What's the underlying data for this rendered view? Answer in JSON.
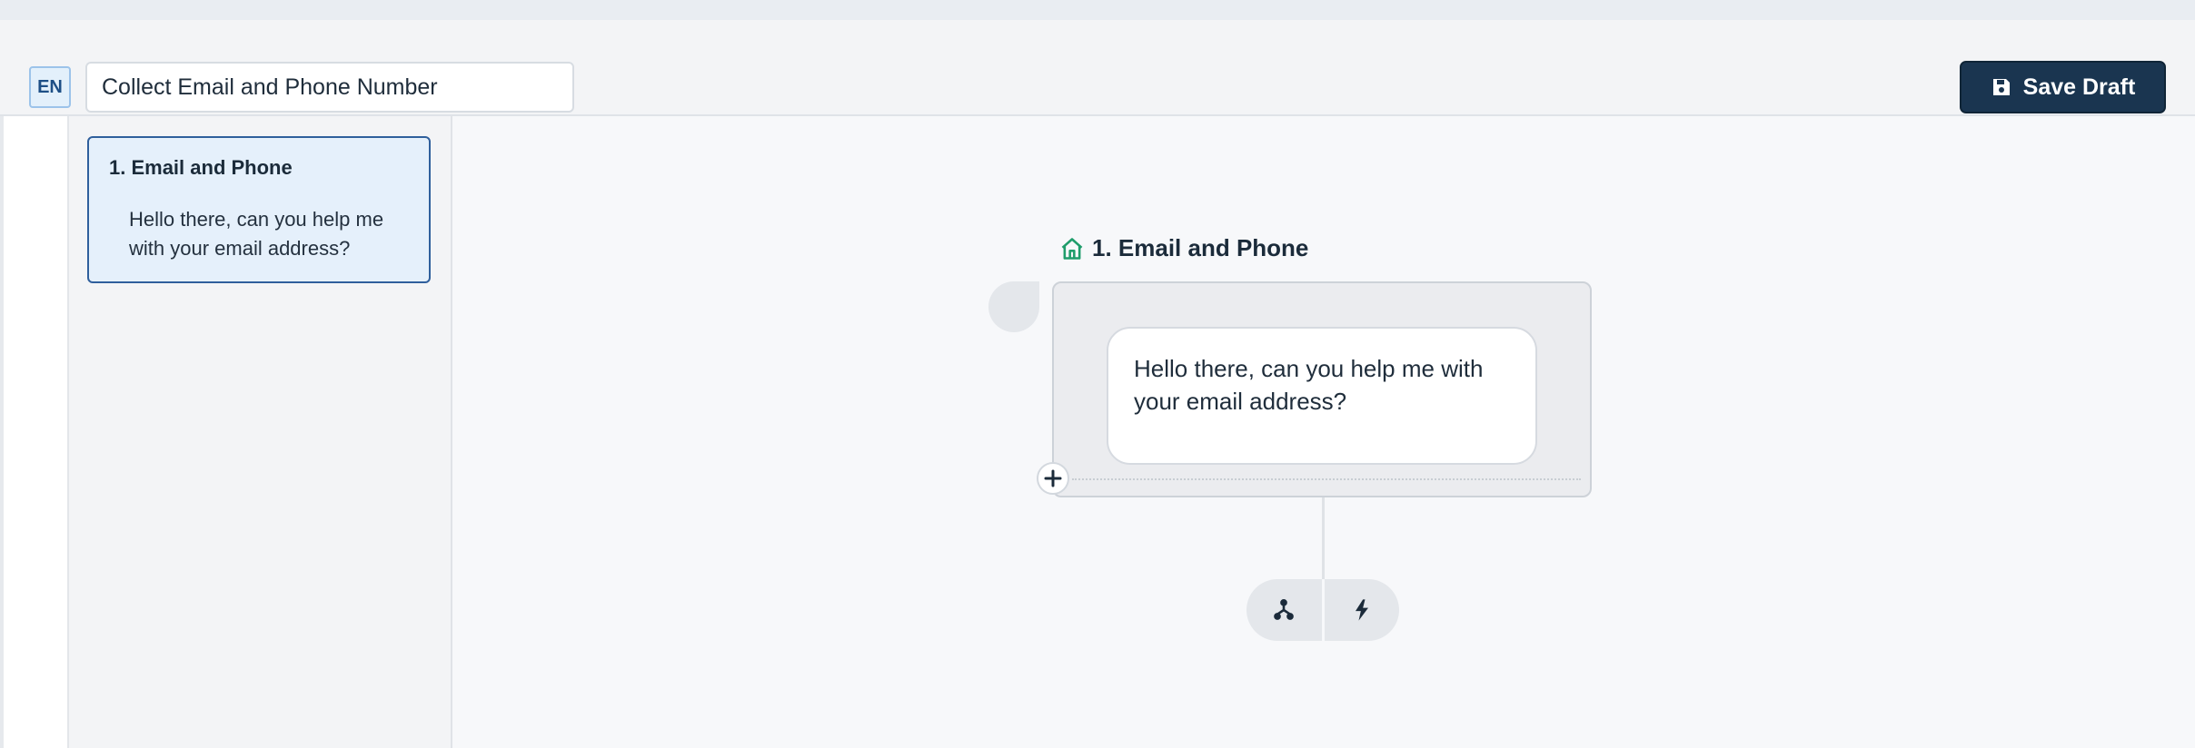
{
  "header": {
    "language_badge": "EN",
    "flow_title": "Collect Email and Phone Number",
    "save_button_label": "Save Draft"
  },
  "outline": {
    "items": [
      {
        "title": "1. Email and Phone",
        "message": "Hello there, can you help me with your email address?"
      }
    ]
  },
  "canvas": {
    "node": {
      "title": "1. Email and Phone",
      "message": "Hello there, can you help me with your email address?",
      "home_icon_color": "#1f9d6b"
    },
    "actions": {
      "branch_icon": "branch-icon",
      "trigger_icon": "lightning-icon"
    }
  },
  "colors": {
    "accent_dark": "#1a3550",
    "selection_border": "#2f5f9c",
    "selection_fill": "#e5f0fb"
  }
}
